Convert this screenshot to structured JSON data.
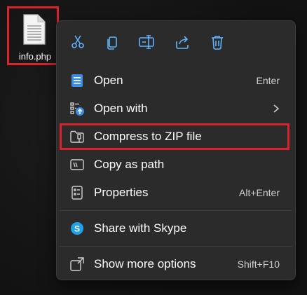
{
  "desktop": {
    "file": {
      "name": "info.php",
      "icon": "document-icon"
    }
  },
  "context_menu": {
    "toolbar": [
      {
        "name": "cut",
        "icon": "scissors-icon"
      },
      {
        "name": "copy",
        "icon": "copy-icon"
      },
      {
        "name": "rename",
        "icon": "rename-icon"
      },
      {
        "name": "share",
        "icon": "share-icon"
      },
      {
        "name": "delete",
        "icon": "trash-icon"
      }
    ],
    "items": [
      {
        "label": "Open",
        "shortcut": "Enter",
        "icon": "open-app-icon"
      },
      {
        "label": "Open with",
        "shortcut": "",
        "icon": "open-with-icon",
        "submenu": true
      },
      {
        "label": "Compress to ZIP file",
        "shortcut": "",
        "icon": "zip-folder-icon"
      },
      {
        "label": "Copy as path",
        "shortcut": "",
        "icon": "copy-path-icon"
      },
      {
        "label": "Properties",
        "shortcut": "Alt+Enter",
        "icon": "properties-icon"
      },
      {
        "label": "Share with Skype",
        "shortcut": "",
        "icon": "skype-icon"
      },
      {
        "label": "Show more options",
        "shortcut": "Shift+F10",
        "icon": "more-options-icon"
      }
    ]
  },
  "colors": {
    "menu_bg": "#2b2b2b",
    "accent": "#60b4ff",
    "highlight": "#d9232f"
  }
}
